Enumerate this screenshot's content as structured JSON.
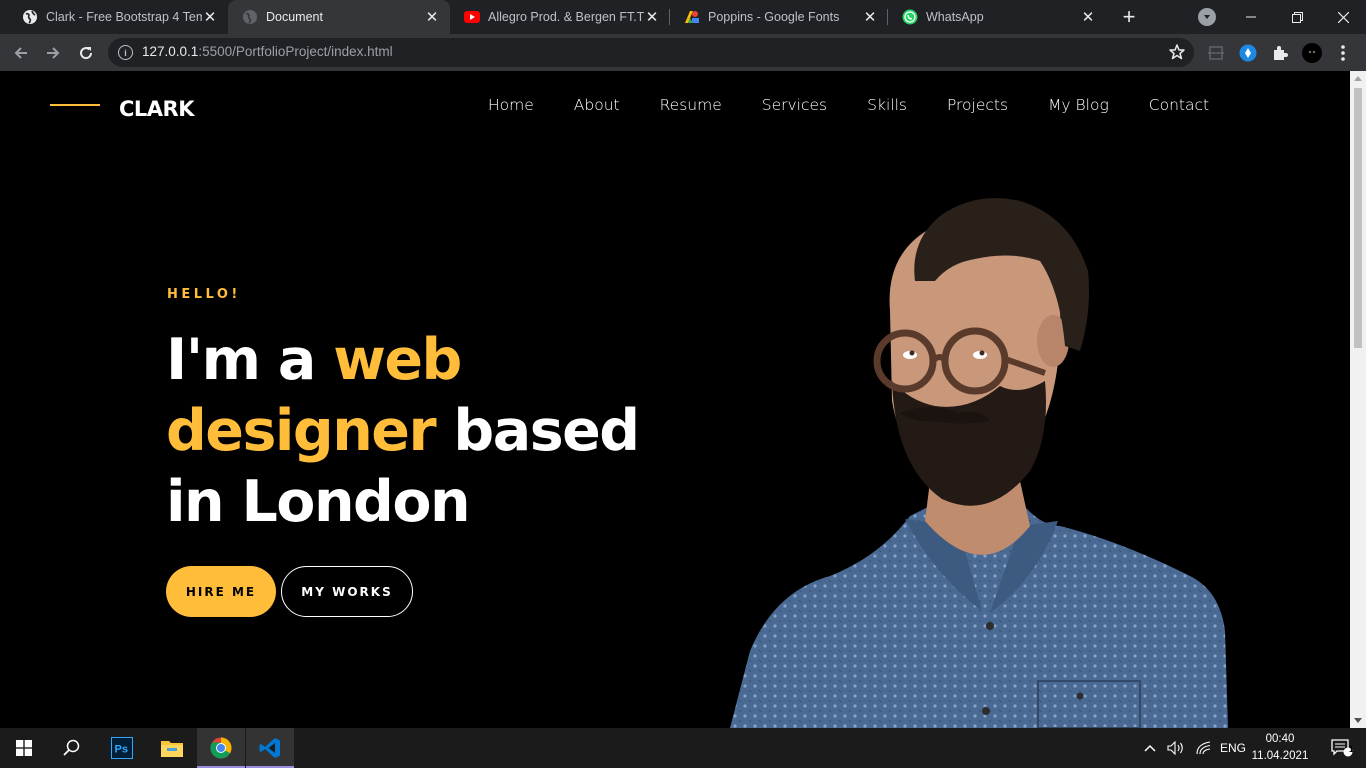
{
  "browser": {
    "tabs": [
      {
        "title": "Clark - Free Bootstrap 4 Temp",
        "favicon": "globe-icon",
        "active": false
      },
      {
        "title": "Document",
        "favicon": "globe-icon",
        "active": true
      },
      {
        "title": "Allegro Prod. & Bergen FT.Tu",
        "favicon": "youtube-icon",
        "active": false
      },
      {
        "title": "Poppins - Google Fonts",
        "favicon": "google-fonts-icon",
        "active": false
      },
      {
        "title": "WhatsApp",
        "favicon": "whatsapp-icon",
        "active": false
      }
    ],
    "url_host": "127.0.0.1",
    "url_rest": ":5500/PortfolioProject/index.html"
  },
  "site": {
    "brand": "CLARK",
    "nav": [
      "Home",
      "About",
      "Resume",
      "Services",
      "Skills",
      "Projects",
      "My Blog",
      "Contact"
    ],
    "hero": {
      "greeting": "HELLO!",
      "line1_a": "I'm a ",
      "line1_b": "web",
      "line2_a": "designer",
      "line2_b": " based",
      "line3": "in London",
      "hire_button": "HIRE ME",
      "works_button": "MY WORKS"
    },
    "colors": {
      "accent": "#ffbd39",
      "background": "#000000"
    }
  },
  "taskbar": {
    "apps": [
      "windows-start-icon",
      "search-icon",
      "photoshop-icon",
      "file-explorer-icon",
      "chrome-icon",
      "vscode-icon"
    ],
    "language": "ENG",
    "time": "00:40",
    "date": "11.04.2021",
    "notification_count": "1"
  }
}
